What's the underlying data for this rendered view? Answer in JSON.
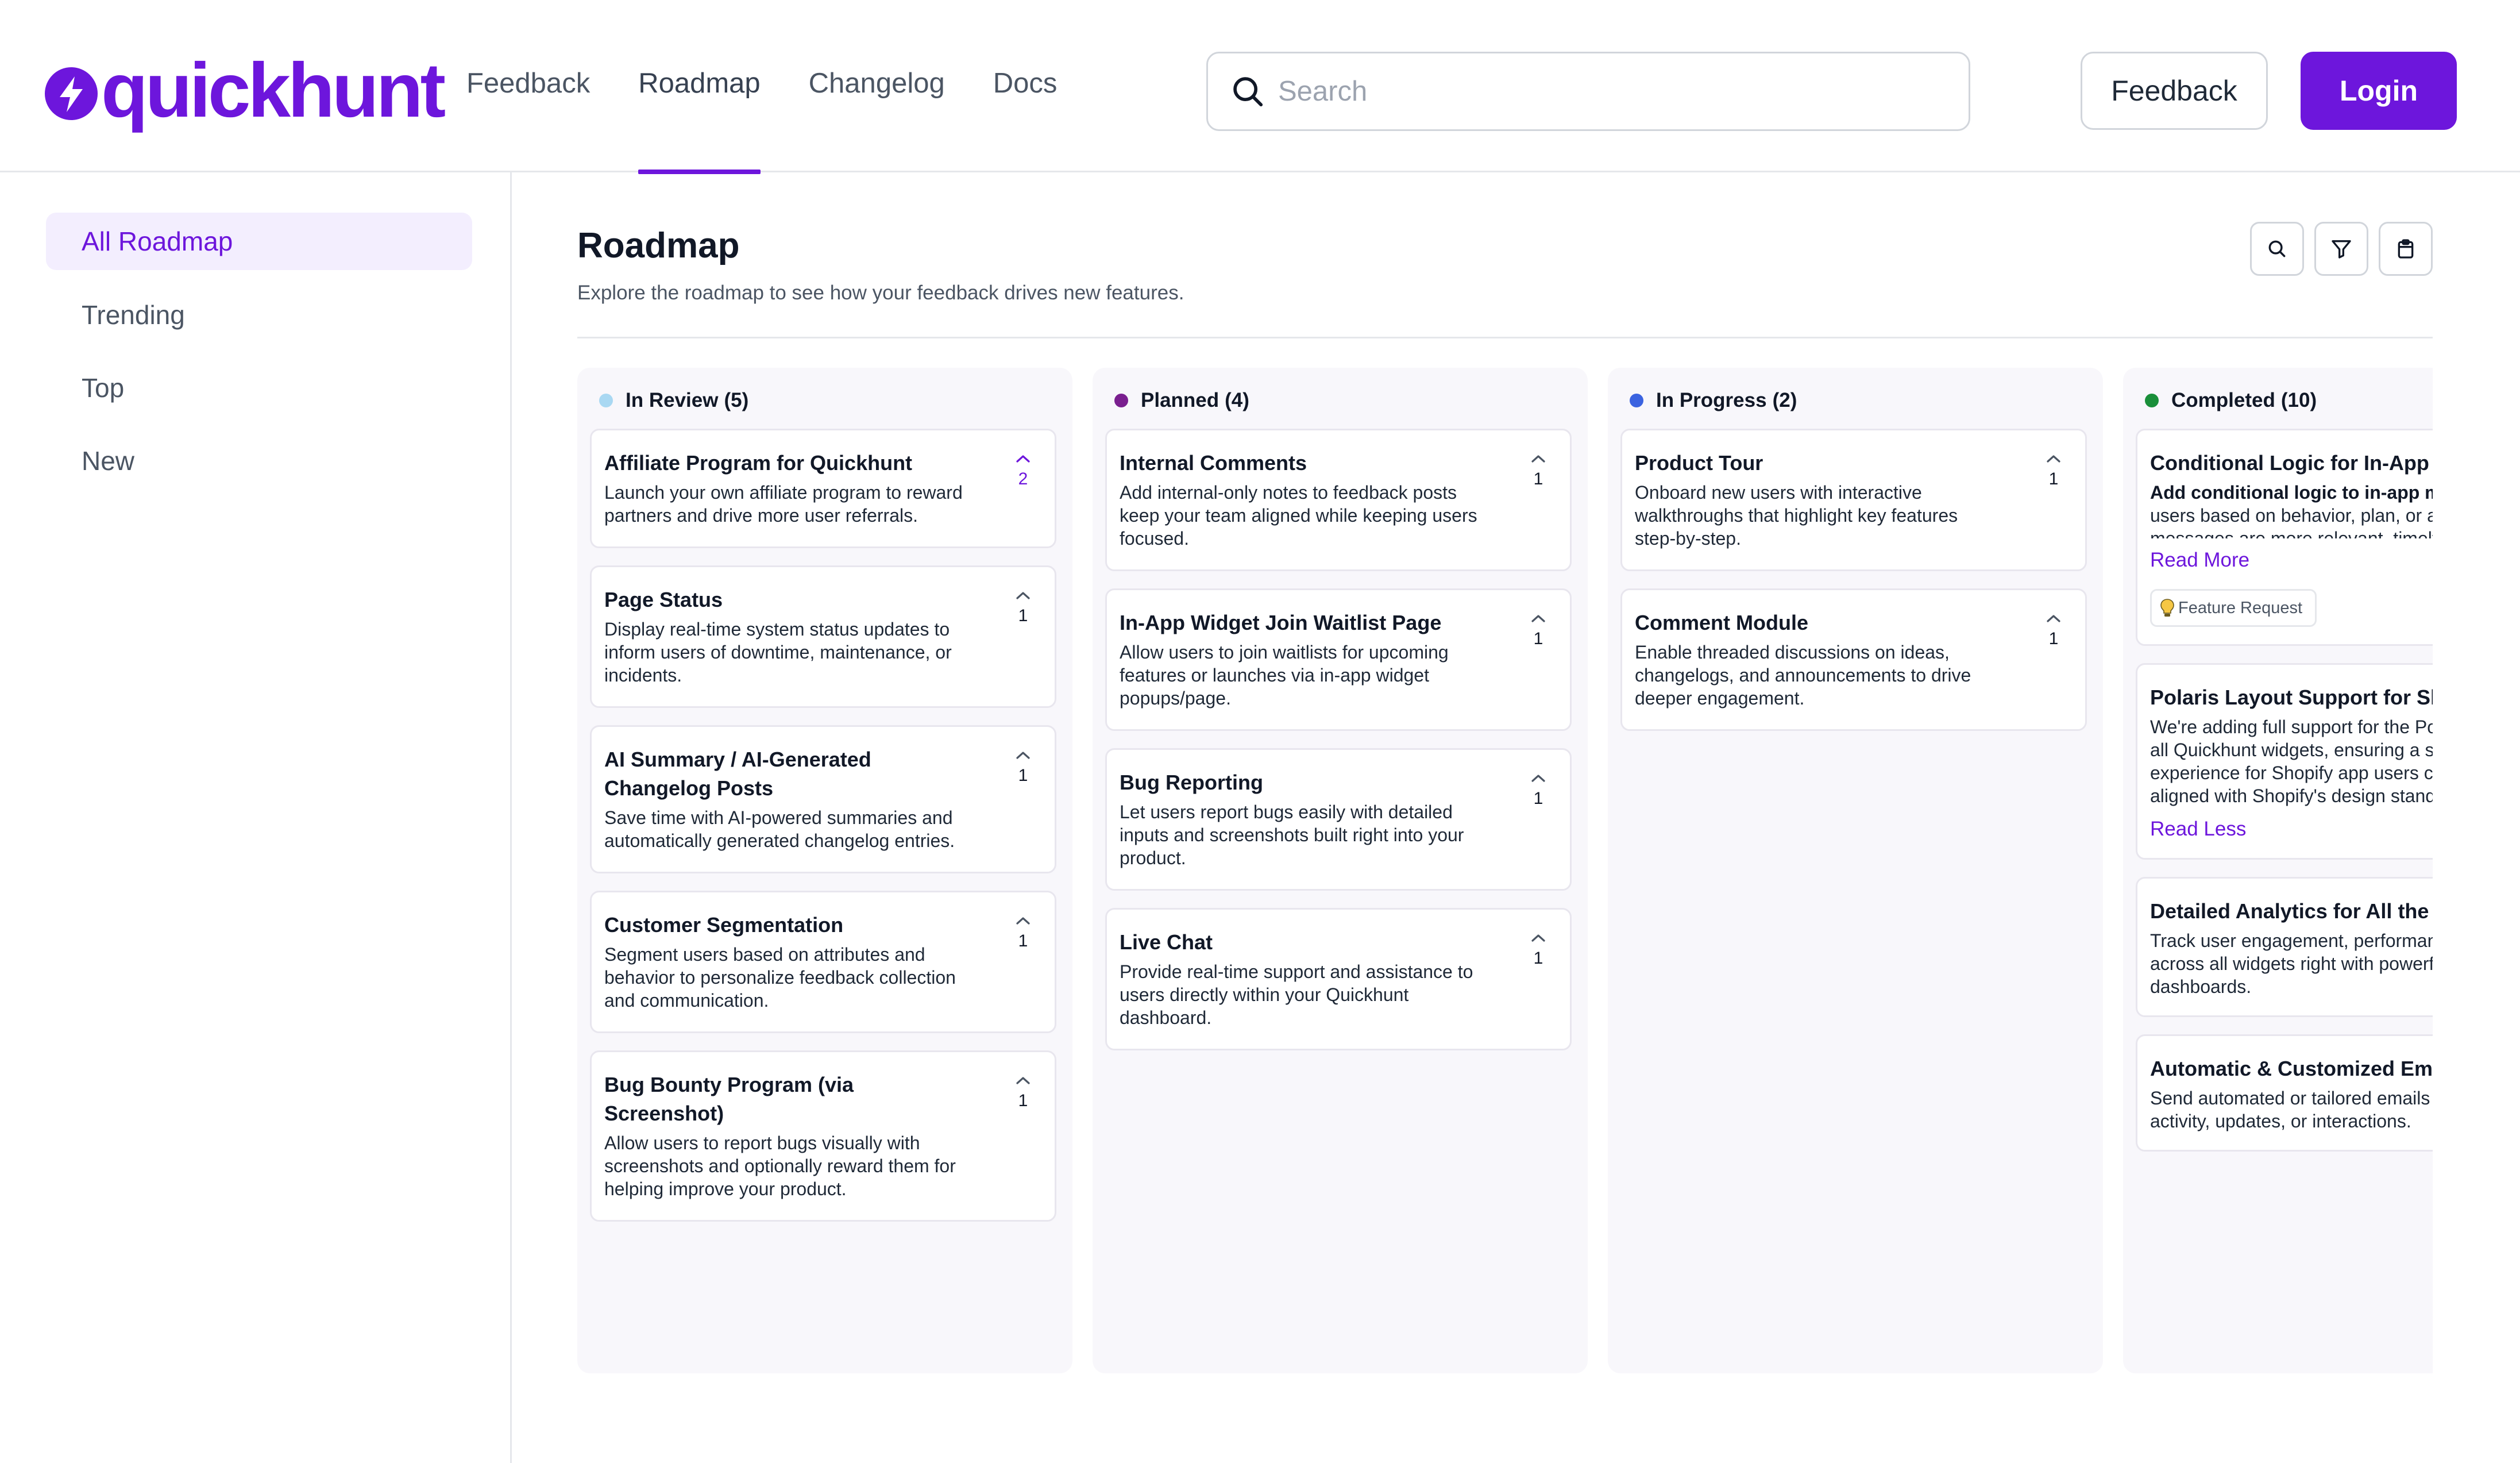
{
  "brand": {
    "name": "quickhunt",
    "color": "#6d16dc"
  },
  "nav": {
    "items": [
      {
        "label": "Feedback",
        "active": false
      },
      {
        "label": "Roadmap",
        "active": true
      },
      {
        "label": "Changelog",
        "active": false
      },
      {
        "label": "Docs",
        "active": false
      }
    ]
  },
  "search": {
    "placeholder": "Search",
    "value": ""
  },
  "header_buttons": {
    "feedback": "Feedback",
    "login": "Login"
  },
  "sidebar": {
    "items": [
      {
        "label": "All Roadmap",
        "active": true
      },
      {
        "label": "Trending",
        "active": false
      },
      {
        "label": "Top",
        "active": false
      },
      {
        "label": "New",
        "active": false
      }
    ]
  },
  "page": {
    "title": "Roadmap",
    "subtitle": "Explore the roadmap to see how your feedback drives new features.",
    "tools": [
      "search-icon",
      "filter-icon",
      "clipboard-icon"
    ]
  },
  "columns": [
    {
      "name": "In Review",
      "count": "(5)",
      "dot_color": "#a9d8f2",
      "cards": [
        {
          "title": "Affiliate Program for Quickhunt",
          "desc": "Launch your own affiliate program to reward partners and drive more user referrals.",
          "votes": "2",
          "voted": true
        },
        {
          "title": "Page Status",
          "desc": "Display real-time system status updates to inform users of downtime, maintenance, or incidents.",
          "votes": "1",
          "voted": false
        },
        {
          "title": "AI Summary / AI-Generated Changelog Posts",
          "desc": "Save time with AI-powered summaries and automatically generated changelog entries.",
          "votes": "1",
          "voted": false
        },
        {
          "title": "Customer Segmentation",
          "desc": "Segment users based on attributes and behavior to personalize feedback collection and communication.",
          "votes": "1",
          "voted": false
        },
        {
          "title": "Bug Bounty Program (via Screenshot)",
          "desc": "Allow users to report bugs visually with screenshots and optionally reward them for helping improve your product.",
          "votes": "1",
          "voted": false
        }
      ]
    },
    {
      "name": "Planned",
      "count": "(4)",
      "dot_color": "#7a1f8f",
      "cards": [
        {
          "title": "Internal Comments",
          "desc": "Add internal-only notes to feedback posts keep your team aligned while keeping users focused.",
          "votes": "1",
          "voted": false
        },
        {
          "title": "In-App Widget Join Waitlist Page",
          "desc": "Allow users to join waitlists for upcoming features or launches via in-app widget popups/page.",
          "votes": "1",
          "voted": false
        },
        {
          "title": "Bug Reporting",
          "desc": "Let users report bugs easily with detailed inputs and screenshots built right into your product.",
          "votes": "1",
          "voted": false
        },
        {
          "title": "Live Chat",
          "desc": "Provide real-time support and assistance to users directly within your Quickhunt dashboard.",
          "votes": "1",
          "voted": false
        }
      ]
    },
    {
      "name": "In Progress",
      "count": "(2)",
      "dot_color": "#3b63e0",
      "cards": [
        {
          "title": "Product Tour",
          "desc": "Onboard new users with interactive walkthroughs that highlight key features step-by-step.",
          "votes": "1",
          "voted": false
        },
        {
          "title": "Comment Module",
          "desc": "Enable threaded discussions on ideas, changelogs, and announcements to drive deeper engagement.",
          "votes": "1",
          "voted": false
        }
      ]
    },
    {
      "name": "Completed",
      "count": "(10)",
      "dot_color": "#1a8f3a",
      "cards": [
        {
          "title": "Conditional Logic for In-App Messages",
          "desc_bold": "Add conditional logic to in-app messages",
          "desc": " to target users based on behavior, plan, or actions—so messages are more relevant, timely, and",
          "link": "Read More",
          "tag": "Feature Request"
        },
        {
          "title": "Polaris Layout Support for Shopify Apps",
          "desc": "We're adding full support for the Polaris layout across all Quickhunt widgets, ensuring a seamless and experience for Shopify app users consistent, and fully aligned with Shopify's design standards.",
          "link": "Read Less"
        },
        {
          "title": "Detailed Analytics for All the widgets",
          "desc": "Track user engagement, performance, and insights across all widgets right with powerful analytics dashboards."
        },
        {
          "title": "Automatic & Customized Emails",
          "desc": "Send automated or tailored emails to users based on activity, updates, or interactions."
        }
      ]
    }
  ]
}
